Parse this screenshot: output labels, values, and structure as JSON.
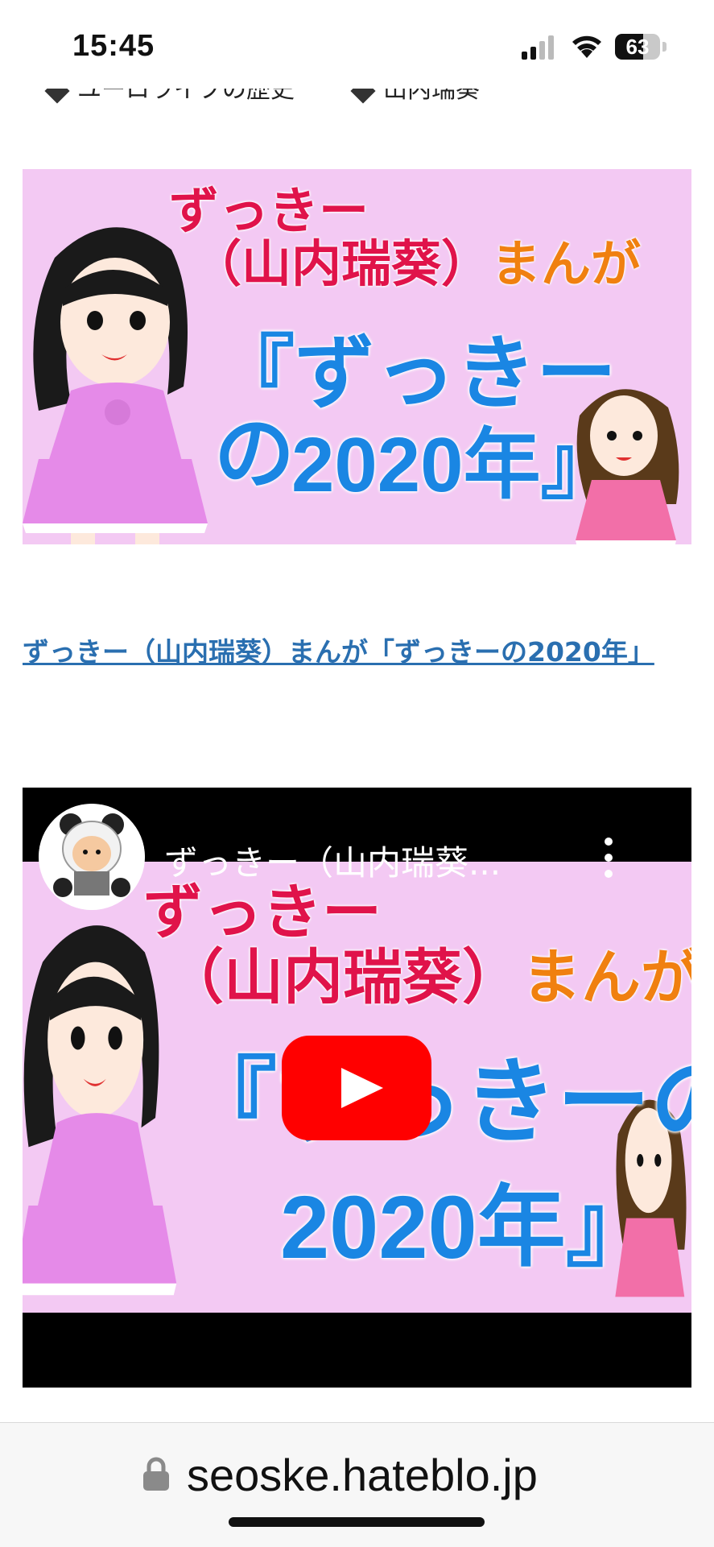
{
  "status": {
    "time": "15:45",
    "battery": "63",
    "battery_level": 0.63
  },
  "nav_partial": {
    "item1": "ユーロライブの歴史",
    "item2": "山内瑞葵"
  },
  "banner": {
    "line1": "ずっきー",
    "line2a": "（山内瑞葵）",
    "line2b": "まんが",
    "line3": "『ずっきーの",
    "line4": "2020年』"
  },
  "article": {
    "link_text": "ずっきー（山内瑞葵）まんが「ずっきーの2020年」"
  },
  "video": {
    "title": "ずっきー（山内瑞葵...",
    "line1": "ずっきー",
    "line2a": "（山内瑞葵）",
    "line2b": "まんが",
    "line3": "『ずっきーの",
    "line4": "2020年』"
  },
  "browser": {
    "url": "seoske.hateblo.jp"
  },
  "colors": {
    "pink_bg": "#f3c9f3",
    "title_red": "#e0134a",
    "title_orange": "#f08010",
    "title_blue": "#1a86e3",
    "link_blue": "#2a6fb0",
    "youtube_red": "#ff0000"
  },
  "icons": [
    "signal-icon",
    "wifi-icon",
    "battery-icon",
    "pin-icon",
    "play-icon",
    "more-vertical-icon",
    "lock-icon"
  ]
}
